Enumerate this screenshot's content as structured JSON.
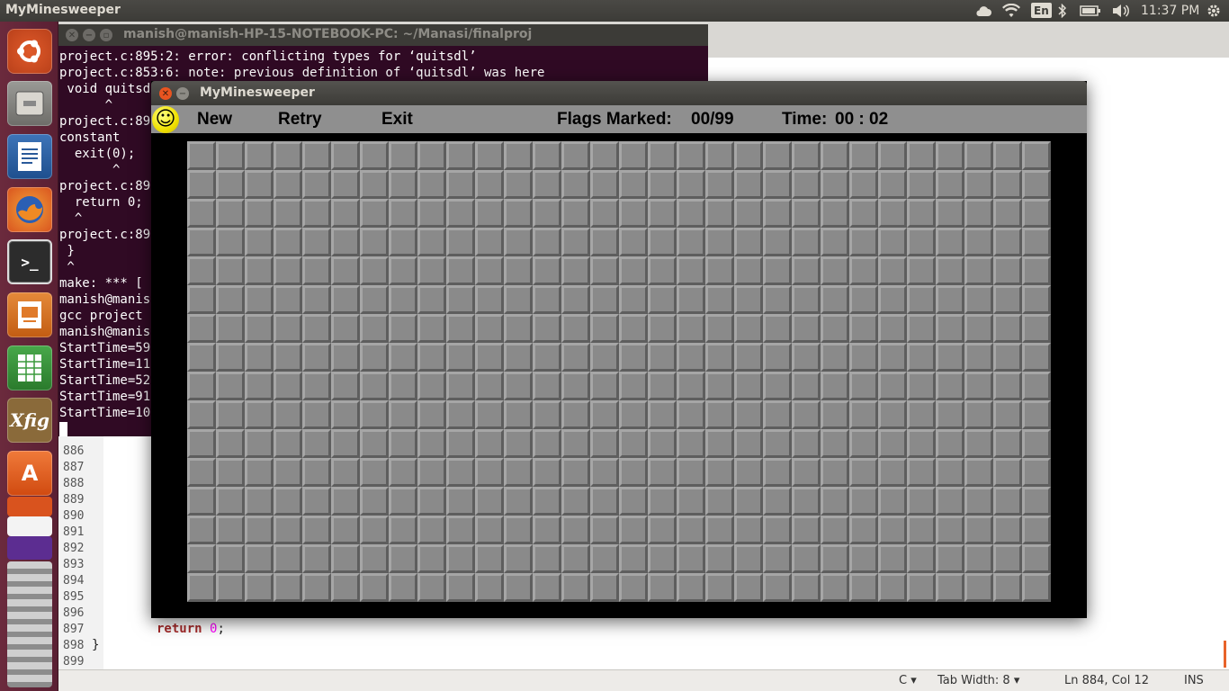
{
  "top_panel": {
    "app_name": "MyMinesweeper",
    "language": "En",
    "clock": "11:37 PM",
    "icons": [
      "cloud-icon",
      "wifi-icon",
      "bluetooth-icon",
      "battery-icon",
      "volume-icon",
      "gear-icon"
    ]
  },
  "launcher": {
    "items": [
      "ubuntu-dash",
      "files",
      "libreoffice-writer",
      "firefox",
      "terminal",
      "libreoffice-impress",
      "libreoffice-calc",
      "xfig",
      "software-center",
      "ubuntu-one",
      "amazon",
      "yahoo-mail",
      "stacked-apps"
    ]
  },
  "terminal": {
    "title": "manish@manish-HP-15-NOTEBOOK-PC: ~/Manasi/finalproj",
    "lines": [
      "project.c:895:2: error: conflicting types for ‘quitsdl’",
      "project.c:853:6: note: previous definition of ‘quitsdl’ was here",
      " void quitsd",
      "      ^",
      "project.c:89",
      "constant",
      "  exit(0);",
      "       ^",
      "project.c:89",
      "  return 0;",
      "  ^",
      "project.c:89",
      " }",
      " ^",
      "make: *** [",
      "manish@manis",
      "gcc project",
      "manish@manis",
      "StartTime=59",
      "StartTime=11",
      "StartTime=52",
      "StartTime=91",
      "StartTime=10"
    ]
  },
  "editor": {
    "line_numbers": [
      "886",
      "887",
      "888",
      "889",
      "890",
      "891",
      "892",
      "893",
      "894",
      "895",
      "896",
      "897",
      "898",
      "899"
    ],
    "code_return": "return",
    "code_zero": "0",
    "code_semicolon": ";",
    "code_brace": "}",
    "status": {
      "language": "C",
      "tab_width": "Tab Width: 8",
      "position": "Ln 884, Col 12",
      "mode": "INS"
    }
  },
  "minesweeper": {
    "title": "MyMinesweeper",
    "menu": {
      "new": "New",
      "retry": "Retry",
      "exit": "Exit"
    },
    "flags_label": "Flags Marked:",
    "flags_value": "00/99",
    "time_label": "Time:",
    "time_value": "00 : 02",
    "grid": {
      "cols": 30,
      "rows": 16
    },
    "colors": {
      "cell": "#8a8a8a",
      "board_bg": "#000000",
      "menubar": "#8f8f8f"
    }
  }
}
